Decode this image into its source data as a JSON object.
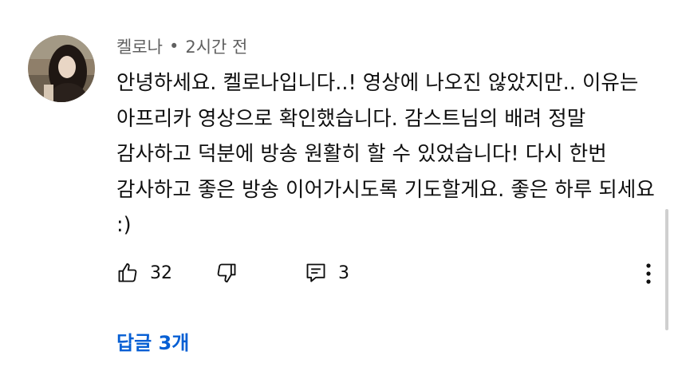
{
  "comment": {
    "author": "켈로나",
    "separator": "•",
    "time": "2시간 전",
    "text": "안녕하세요. 켈로나입니다..! 영상에 나오진 않았지만.. 이유는 아프리카 영상으로 확인했습니다. 감스트님의 배려 정말 감사하고 덕분에 방송 원활히 할 수 있었습니다! 다시 한번 감사하고 좋은 방송 이어가시도록 기도할게요. 좋은 하루 되세요 :)",
    "like_count": "32",
    "reply_count": "3",
    "replies_link": "답글 3개"
  },
  "icons": {
    "like": "thumbs-up-icon",
    "dislike": "thumbs-down-icon",
    "reply": "comment-icon",
    "more": "more-vertical-icon"
  },
  "colors": {
    "link": "#065fd4",
    "meta": "#606060",
    "text": "#0f0f0f"
  }
}
